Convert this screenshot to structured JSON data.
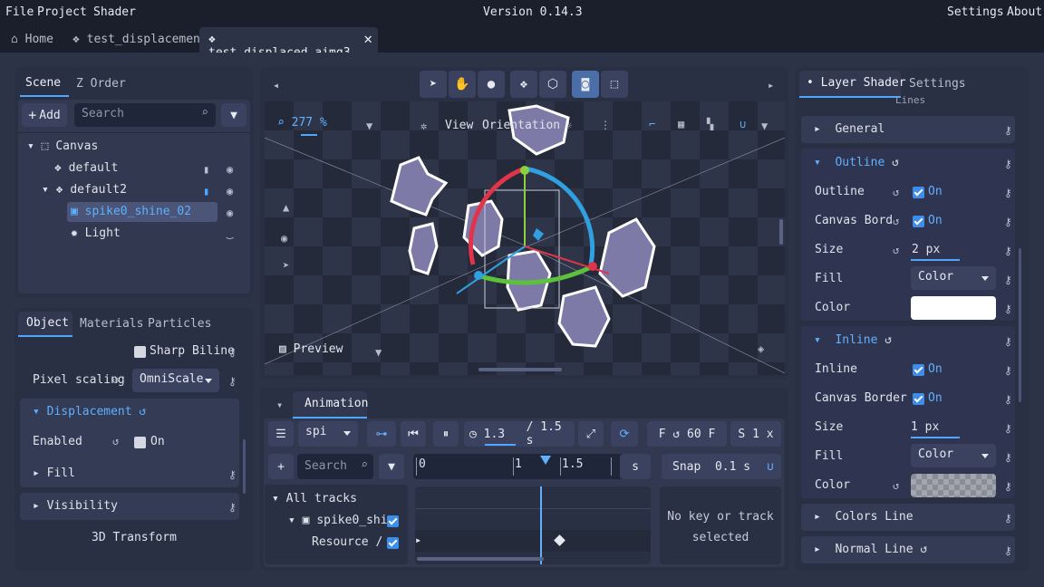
{
  "menu": {
    "file": "File",
    "project": "Project",
    "shader": "Shader",
    "version": "Version 0.14.3",
    "settings": "Settings",
    "about": "About"
  },
  "tabs": {
    "home": "Home",
    "t1": "test_displacement",
    "t2": "test_displaced_aimg3..."
  },
  "scene": {
    "tab_scene": "Scene",
    "tab_zorder": "Z Order",
    "add": "Add",
    "search_placeholder": "Search",
    "tree": {
      "canvas": "Canvas",
      "default": "default",
      "default2": "default2",
      "spike": "spike0_shine_02",
      "light": "Light"
    }
  },
  "object": {
    "tab_object": "Object",
    "tab_materials": "Materials",
    "tab_particles": "Particles",
    "sharp_biline": "Sharp Biline",
    "pixel_scaling": "Pixel scaling",
    "pixel_scaling_value": "OmniScale",
    "displacement": "Displacement",
    "enabled": "Enabled",
    "on": "On",
    "fill": "Fill",
    "visibility": "Visibility",
    "transform3d": "3D Transform"
  },
  "viewport": {
    "zoom": "277 %",
    "view": "View",
    "orientation": "Orientation",
    "preview": "Preview"
  },
  "animation": {
    "tab": "Animation",
    "anim_name": "spi",
    "time": "1.3",
    "duration": "/ 1.5 s",
    "fps_label": "F",
    "fps": "60 F",
    "speed_label": "S",
    "speed": "1 x",
    "search_placeholder": "Search",
    "t0": "0",
    "t1": "1",
    "t15": "1.5",
    "unit": "s",
    "snap": "Snap",
    "snap_val": "0.1 s",
    "all_tracks": "All tracks",
    "track1": "spike0_shi",
    "track2": "Resource /",
    "no_key": "No key or track selected"
  },
  "shader": {
    "tab_layer": "Layer Shader",
    "tab_settings": "Settings",
    "lines_hint": "Lines",
    "general": "General",
    "outline": "Outline",
    "outline_lbl": "Outline",
    "on": "On",
    "canvas_bord": "Canvas Bord",
    "size": "Size",
    "size_val1": "2 px",
    "fill": "Fill",
    "fill_val": "Color",
    "color": "Color",
    "inline": "Inline",
    "inline_lbl": "Inline",
    "canvas_border": "Canvas Border",
    "size_val2": "1 px",
    "colors_line": "Colors Line",
    "normal_line": "Normal Line"
  }
}
